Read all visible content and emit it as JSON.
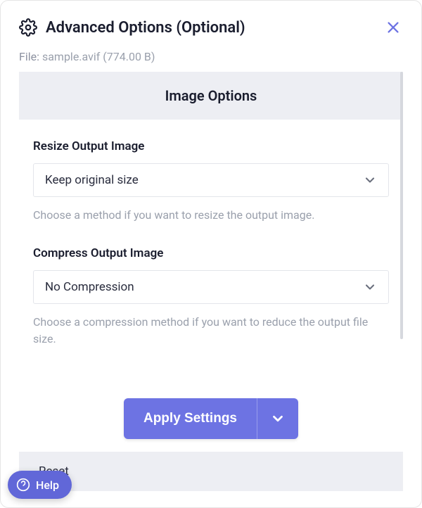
{
  "header": {
    "title": "Advanced Options (Optional)"
  },
  "file": {
    "label": "File:",
    "name": "sample.avif",
    "size": "(774.00 B)"
  },
  "panel": {
    "title": "Image Options",
    "fields": {
      "resize": {
        "label": "Resize Output Image",
        "value": "Keep original size",
        "helper": "Choose a method if you want to resize the output image."
      },
      "compress": {
        "label": "Compress Output Image",
        "value": "No Compression",
        "helper": "Choose a compression method if you want to reduce the output file size."
      }
    }
  },
  "actions": {
    "apply": "Apply Settings",
    "reset": "Reset"
  },
  "help": {
    "label": "Help"
  }
}
